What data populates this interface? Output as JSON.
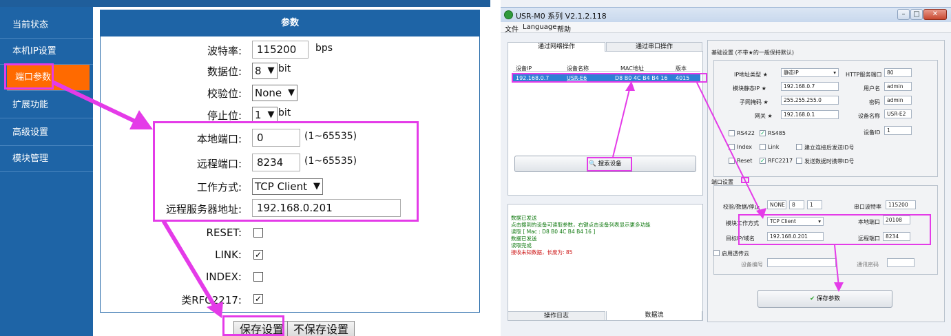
{
  "web": {
    "sidebar": [
      "当前状态",
      "本机IP设置",
      "端口参数",
      "扩展功能",
      "高级设置",
      "模块管理"
    ],
    "panel_title": "参数",
    "baud": {
      "label": "波特率:",
      "value": "115200",
      "unit": "bps"
    },
    "databits": {
      "label": "数据位:",
      "value": "8",
      "unit": "bit"
    },
    "parity": {
      "label": "校验位:",
      "value": "None"
    },
    "stopbits": {
      "label": "停止位:",
      "value": "1",
      "unit": "bit"
    },
    "local_port": {
      "label": "本地端口:",
      "value": "0",
      "range": "(1~65535)"
    },
    "remote_port": {
      "label": "远程端口:",
      "value": "8234",
      "range": "(1~65535)"
    },
    "work_mode": {
      "label": "工作方式:",
      "value": "TCP Client"
    },
    "server_addr": {
      "label": "远程服务器地址:",
      "value": "192.168.0.201"
    },
    "reset": {
      "label": "RESET:",
      "checked": false
    },
    "link": {
      "label": "LINK:",
      "checked": true
    },
    "index": {
      "label": "INDEX:",
      "checked": false
    },
    "rfc2217": {
      "label": "类RFC2217:",
      "checked": true
    },
    "save_label": "保存设置",
    "nosave_label": "不保存设置"
  },
  "app": {
    "title": "USR-M0 系列 V2.1.2.118",
    "menu": [
      "文件",
      "Language",
      "帮助"
    ],
    "tabs": [
      "通过网络操作",
      "通过串口操作"
    ],
    "table_headers": [
      "设备IP",
      "设备名称",
      "MAC地址",
      "版本"
    ],
    "device_row": [
      "192.168.0.7",
      "USR-E6",
      "D8 B0 4C B4 B4 16",
      "4015"
    ],
    "search_label": "搜索设备",
    "log_lines": [
      {
        "text": "数据已发送",
        "color": "#127a12"
      },
      {
        "text": "点击搜到的设备可读取参数，右键点击设备列表显示更多功能",
        "color": "#127a12"
      },
      {
        "text": "读取 [ Mac : D8 B0 4C B4 B4 16 ]",
        "color": "#127a12"
      },
      {
        "text": "数据已发送",
        "color": "#127a12"
      },
      {
        "text": "读取完成",
        "color": "#127a12"
      },
      {
        "text": "  接收未知数据，长度为: 85",
        "color": "#cc1111"
      }
    ],
    "bottom_tabs": [
      "操作日志",
      "数据流"
    ],
    "basic_title": "基础设置 (不带★的一般保持默认)",
    "ip_type_label": "IP地址类型 ★",
    "ip_type": "静态IP",
    "static_ip_label": "模块静态IP ★",
    "static_ip": "192.168.0.7",
    "mask_label": "子网掩码 ★",
    "mask": "255.255.255.0",
    "gateway_label": "网关 ★",
    "gateway": "192.168.0.1",
    "http_port_label": "HTTP服务端口",
    "http_port": "80",
    "user_label": "用户名",
    "user": "admin",
    "pwd_label": "密码",
    "pwd": "admin",
    "devname_label": "设备名称",
    "devname": "USR-E2",
    "devid_label": "设备ID",
    "devid": "1",
    "chk_rs422": "RS422",
    "chk_rs485": "RS485",
    "chk_index": "Index",
    "chk_link": "Link",
    "chk_send_id": "建立连接后发送ID号",
    "chk_reset": "Reset",
    "chk_rfc": "RFC2217",
    "chk_send_data_id": "发送数据时携带ID号",
    "port_title": "端口设置",
    "serial_label": "校验/数据/停止",
    "parity": "NONE",
    "databits": "8",
    "stopbits": "1",
    "baud_label": "串口波特率",
    "baud": "115200",
    "mode_label": "模块工作方式",
    "mode": "TCP Client",
    "local_port_label": "本地端口",
    "local_port": "20108",
    "target_label": "目标IP/域名",
    "target": "192.168.0.201",
    "remote_port_label": "远程端口",
    "remote_port": "8234",
    "cloud_label": "启用透传云",
    "dev_no_label": "设备编号",
    "comm_pwd_label": "通讯密码",
    "save_params_label": "保存参数"
  }
}
